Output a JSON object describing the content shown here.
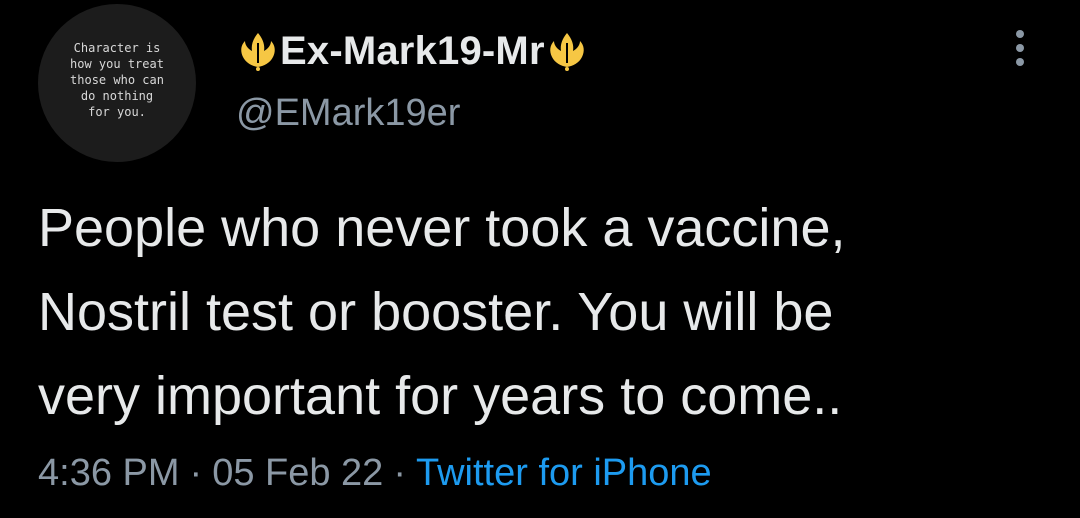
{
  "avatar": {
    "text": "Character is\nhow you treat\nthose who can\ndo nothing\nfor you."
  },
  "author": {
    "display_name": "Ex-Mark19-Mr",
    "handle": "@EMark19er",
    "emblem_icon": "rebel-alliance-icon",
    "emblem_color": "#f6c744"
  },
  "tweet": {
    "text_lines": [
      "People who never took a vaccine,",
      "Nostril test or booster. You will be",
      "very important for years to come.."
    ]
  },
  "meta": {
    "time": "4:36 PM",
    "date": "05 Feb 22",
    "separator": "·",
    "source": "Twitter for iPhone"
  },
  "colors": {
    "background": "#000000",
    "primary_text": "#e7e9ea",
    "secondary_text": "#8b98a5",
    "link": "#1d9bf0"
  }
}
